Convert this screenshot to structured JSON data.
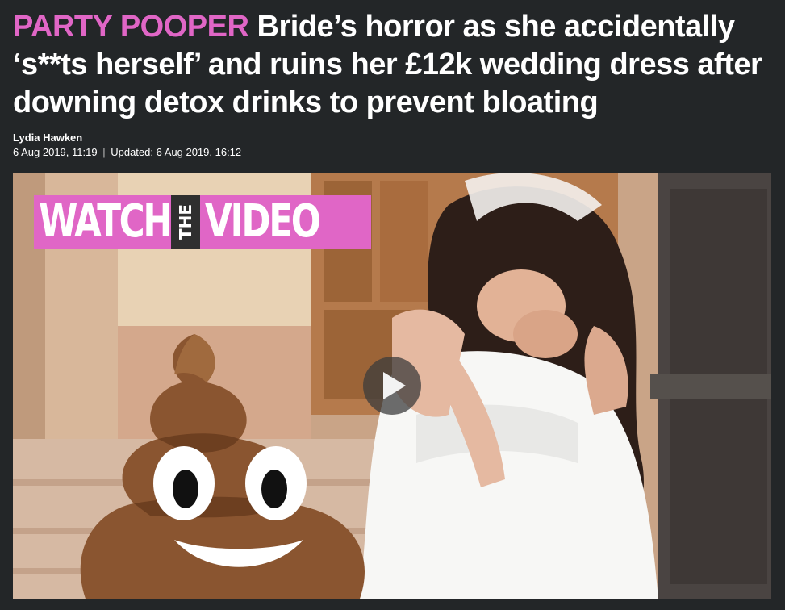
{
  "article": {
    "kicker": "PARTY POOPER",
    "headline": "Bride’s horror as she accidentally ‘s**ts herself’ and ruins her £12k wedding dress after downing detox drinks to prevent bloating",
    "author": "Lydia Hawken",
    "published": "6 Aug 2019, 11:19",
    "separator": "|",
    "updated": "Updated: 6 Aug 2019, 16:12"
  },
  "video": {
    "banner_watch": "WATCH",
    "banner_the": "THE",
    "banner_video": "VIDEO",
    "play_icon": "play-icon",
    "emoji_icon": "pile-of-poo-emoji"
  },
  "colors": {
    "background": "#232628",
    "kicker_pink": "#e066c6",
    "headline_text": "#ffffff"
  }
}
